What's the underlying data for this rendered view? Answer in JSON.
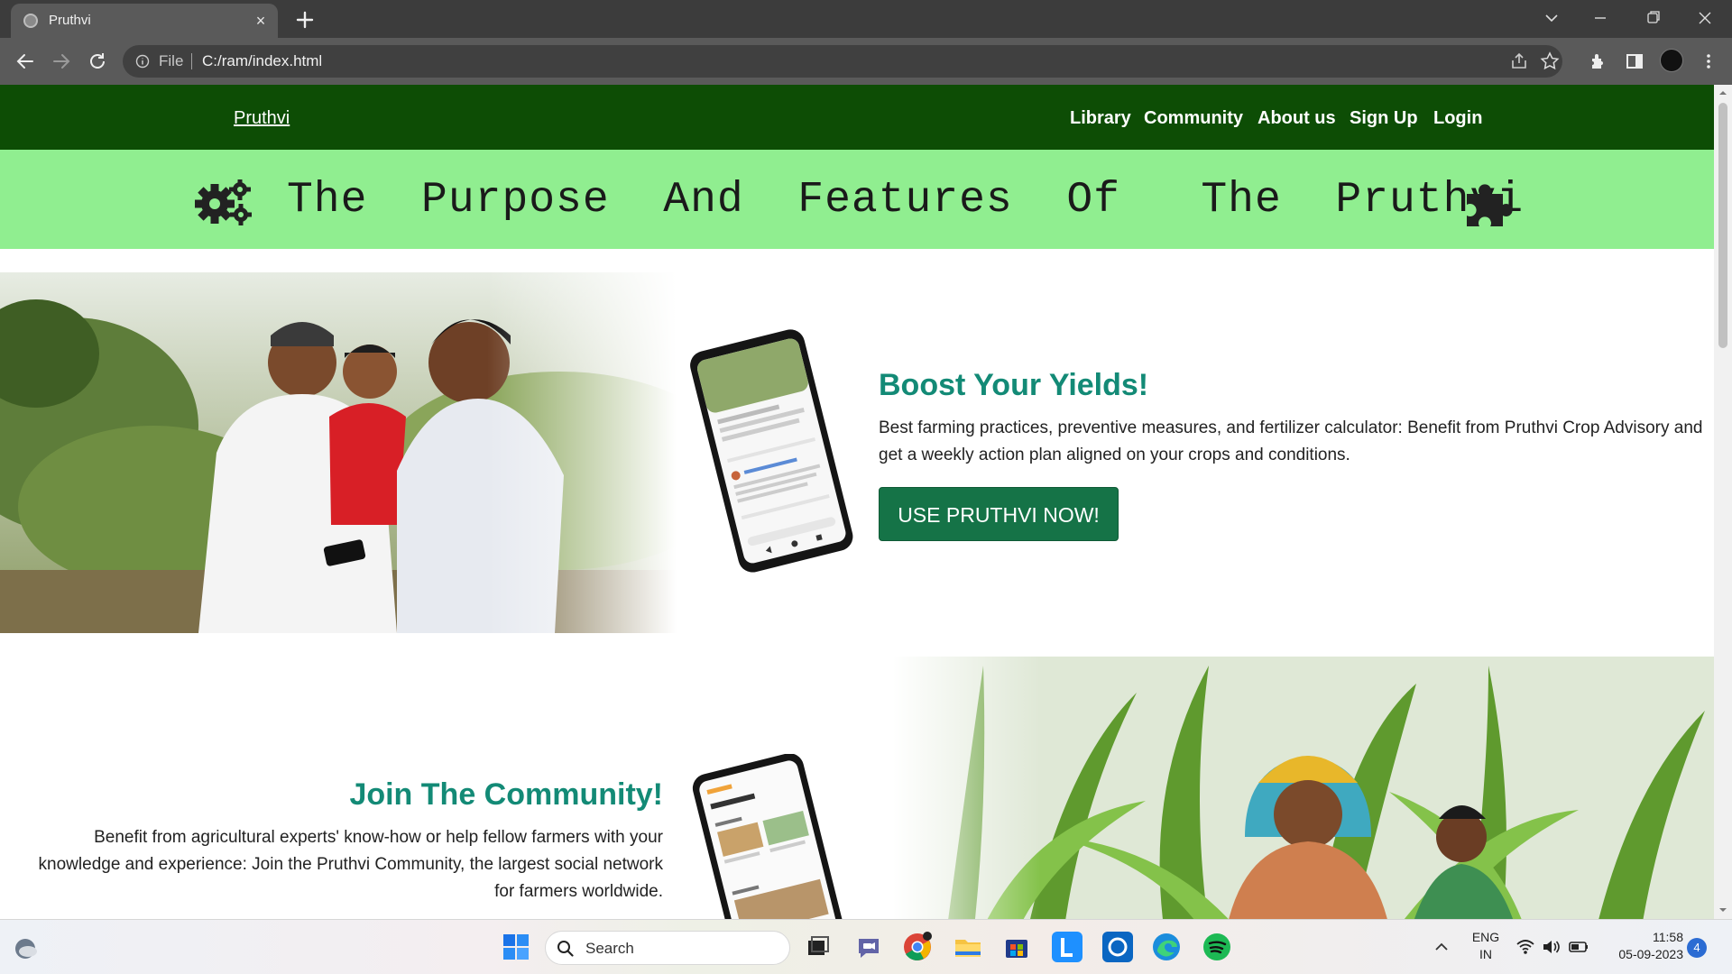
{
  "browser": {
    "tab_title": "Pruthvi",
    "tab_close": "×",
    "address": {
      "scheme_label": "File",
      "url": "C:/ram/index.html"
    }
  },
  "site": {
    "brand": "Pruthvi",
    "nav": [
      "Library",
      "Community",
      "About us",
      "Sign Up",
      "Login"
    ],
    "banner_title": "The  Purpose  And  Features  Of   The  Pruthvi",
    "section1": {
      "title": "Boost Your Yields!",
      "description": "Best farming practices, preventive measures, and fertilizer calculator: Benefit from Pruthvi Crop Advisory and get a weekly action plan aligned on your crops and conditions.",
      "cta": "USE PRUTHVI NOW!"
    },
    "section2": {
      "title": "Join The Community!",
      "description": "Benefit from agricultural experts' know-how or help fellow farmers with your knowledge and experience: Join the Pruthvi Community, the largest social network for farmers worldwide."
    }
  },
  "taskbar": {
    "search_placeholder": "Search",
    "lang_line1": "ENG",
    "lang_line2": "IN",
    "time": "11:58",
    "date": "05-09-2023",
    "notification_count": "4"
  },
  "colors": {
    "nav_bg": "#0d4d05",
    "banner_bg": "#90ee90",
    "heading": "#138a76",
    "cta_bg": "#157347"
  }
}
